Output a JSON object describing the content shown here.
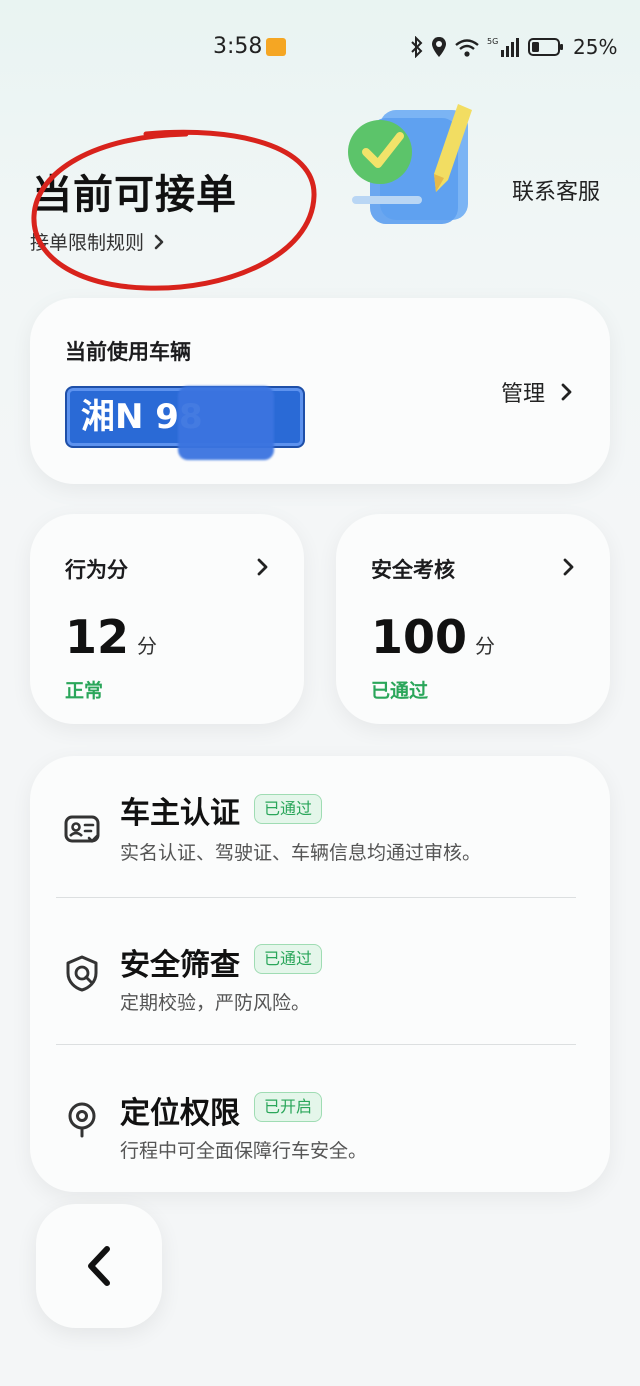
{
  "status_bar": {
    "time": "3:58",
    "battery": "25%",
    "network": "5G",
    "icons": [
      "app-notification-icon",
      "bluetooth-icon",
      "location-icon",
      "wifi-icon",
      "signal-icon",
      "battery-icon"
    ]
  },
  "header": {
    "title": "当前可接单",
    "rules_link": "接单限制规则",
    "service_link": "联系客服",
    "illustration": "checklist-pencil-illustration",
    "annotation_color": "#d8231c"
  },
  "vehicle": {
    "label": "当前使用车辆",
    "plate": "湘N    98",
    "manage": "管理",
    "plate_color": "#2a6ad6"
  },
  "behavior_score": {
    "label": "行为分",
    "value": "12",
    "unit": "分",
    "status": "正常"
  },
  "safety_review": {
    "label": "安全考核",
    "value": "100",
    "unit": "分",
    "status": "已通过"
  },
  "checks": [
    {
      "title": "车主认证",
      "badge": "已通过",
      "desc": "实名认证、驾驶证、车辆信息均通过审核。",
      "icon": "id-card-icon"
    },
    {
      "title": "安全筛查",
      "badge": "已通过",
      "desc": "定期校验，严防风险。",
      "icon": "shield-search-icon"
    },
    {
      "title": "定位权限",
      "badge": "已开启",
      "desc": "行程中可全面保障行车安全。",
      "icon": "location-target-icon"
    }
  ],
  "accent_green": "#2aa65a",
  "back_button": "back-chevron-icon"
}
